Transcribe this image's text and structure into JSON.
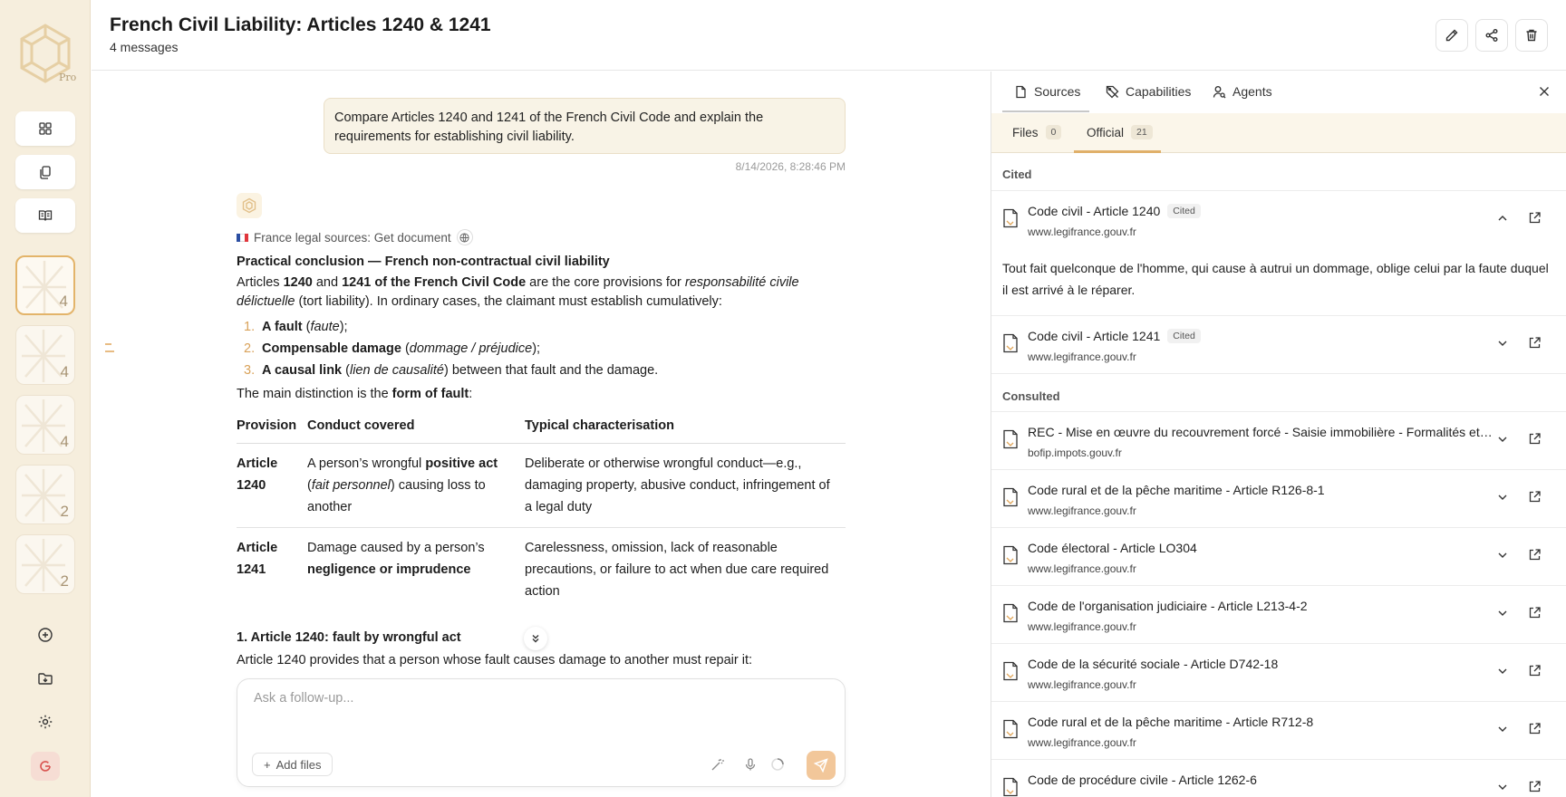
{
  "app": {
    "plan_badge": "Pro"
  },
  "header": {
    "title": "French Civil Liability: Articles 1240 & 1241",
    "subtitle": "4 messages"
  },
  "rail": {
    "thumb_counts": [
      "4",
      "4",
      "4",
      "2",
      "2"
    ]
  },
  "chat": {
    "user_message": "Compare Articles 1240 and 1241 of the French Civil Code and explain the requirements for establishing civil liability.",
    "timestamp": "8/14/2026, 8:28:46 PM",
    "tool_call": "France legal sources: Get document",
    "answer": {
      "heading": "Practical conclusion — French non-contractual civil liability",
      "intro": {
        "p1": "Articles ",
        "b1": "1240",
        "p2": " and ",
        "b2": "1241 of the French Civil Code",
        "p3": " are the core provisions for ",
        "i1": "responsabilité civile délictuelle",
        "p4": " (tort liability). In ordinary cases, the claimant must establish cumulatively:"
      },
      "requirements": [
        {
          "num": "1.",
          "bold": "A fault",
          "pre": " (",
          "italic": "faute",
          "post": ");"
        },
        {
          "num": "2.",
          "bold": "Compensable damage",
          "pre": " (",
          "italic": "dommage / préjudice",
          "post": ");"
        },
        {
          "num": "3.",
          "bold": "A causal link",
          "pre": " (",
          "italic": "lien de causalité",
          "post": ") between that fault and the damage."
        }
      ],
      "distinction": {
        "pre": "The main distinction is the ",
        "bold": "form of fault",
        "post": ":"
      },
      "table": {
        "headers": [
          "Provision",
          "Conduct covered",
          "Typical characterisation"
        ],
        "row1": {
          "provision": "Article 1240",
          "conduct_pre": "A person’s wrongful ",
          "conduct_bold": "positive act",
          "conduct_mid": " (",
          "conduct_italic": "fait personnel",
          "conduct_post": ") causing loss to another",
          "characterisation": "Deliberate or otherwise wrongful conduct—e.g., damaging property, abusive conduct, infringement of a legal duty"
        },
        "row2": {
          "provision": "Article 1241",
          "conduct_pre": "Damage caused by a person’s ",
          "conduct_bold": "negligence or imprudence",
          "characterisation": "Carelessness, omission, lack of reasonable precautions, or failure to act when due care required action"
        }
      },
      "section_heading": "1. Article 1240: fault by wrongful act",
      "section_text": "Article 1240 provides that a person whose fault causes damage to another must repair it:"
    },
    "composer": {
      "placeholder": "Ask a follow-up...",
      "add_files_label": "Add files"
    }
  },
  "panel": {
    "tabs": [
      "Sources",
      "Capabilities",
      "Agents"
    ],
    "subtabs": [
      {
        "label": "Files",
        "count": "0"
      },
      {
        "label": "Official",
        "count": "21"
      }
    ],
    "cited_label": "Cited",
    "consulted_label": "Consulted",
    "cited_badge": "Cited",
    "cited": [
      {
        "title": "Code civil - Article 1240",
        "domain": "www.legifrance.gouv.fr",
        "expanded": true
      },
      {
        "title": "Code civil - Article 1241",
        "domain": "www.legifrance.gouv.fr",
        "expanded": false
      }
    ],
    "excerpt": "Tout fait quelconque de l'homme, qui cause à autrui un dommage, oblige celui par la faute duquel il est arrivé à le réparer.",
    "consulted": [
      {
        "title": "REC - Mise en œuvre du recouvrement forcé - Saisie immobilière - Formalités et…",
        "domain": "bofip.impots.gouv.fr"
      },
      {
        "title": "Code rural et de la pêche maritime - Article R126-8-1",
        "domain": "www.legifrance.gouv.fr"
      },
      {
        "title": "Code électoral - Article LO304",
        "domain": "www.legifrance.gouv.fr"
      },
      {
        "title": "Code de l'organisation judiciaire - Article L213-4-2",
        "domain": "www.legifrance.gouv.fr"
      },
      {
        "title": "Code de la sécurité sociale - Article D742-18",
        "domain": "www.legifrance.gouv.fr"
      },
      {
        "title": "Code rural et de la pêche maritime - Article R712-8",
        "domain": "www.legifrance.gouv.fr"
      },
      {
        "title": "Code de procédure civile - Article 1262-6",
        "domain": ""
      }
    ]
  },
  "colors": {
    "accent": "#e0b06a",
    "rail_bg": "#f6eedd",
    "user_bubble": "#f8f3e6",
    "send": "#f2c79a"
  }
}
